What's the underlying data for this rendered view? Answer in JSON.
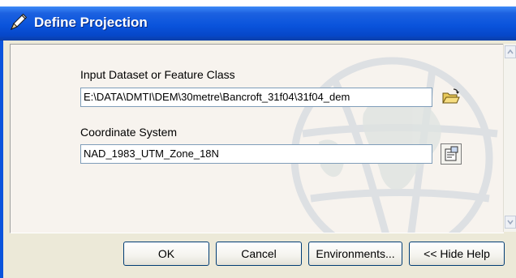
{
  "window": {
    "title": "Define Projection",
    "title_icon": "pencil-icon"
  },
  "form": {
    "input_label": "Input Dataset or Feature Class",
    "input_value": "E:\\DATA\\DMTI\\DEM\\30metre\\Bancroft_31f04\\31f04_dem",
    "input_browse_icon": "open-folder-icon",
    "coord_label": "Coordinate System",
    "coord_value": "NAD_1983_UTM_Zone_18N",
    "coord_props_icon": "properties-icon"
  },
  "buttons": {
    "ok": "OK",
    "cancel": "Cancel",
    "environments": "Environments...",
    "hide_help": "<< Hide Help"
  },
  "colors": {
    "titlebar": "#0a54dc",
    "dialog_bg": "#ece9d8",
    "panel_bg": "#f7f3ee"
  }
}
